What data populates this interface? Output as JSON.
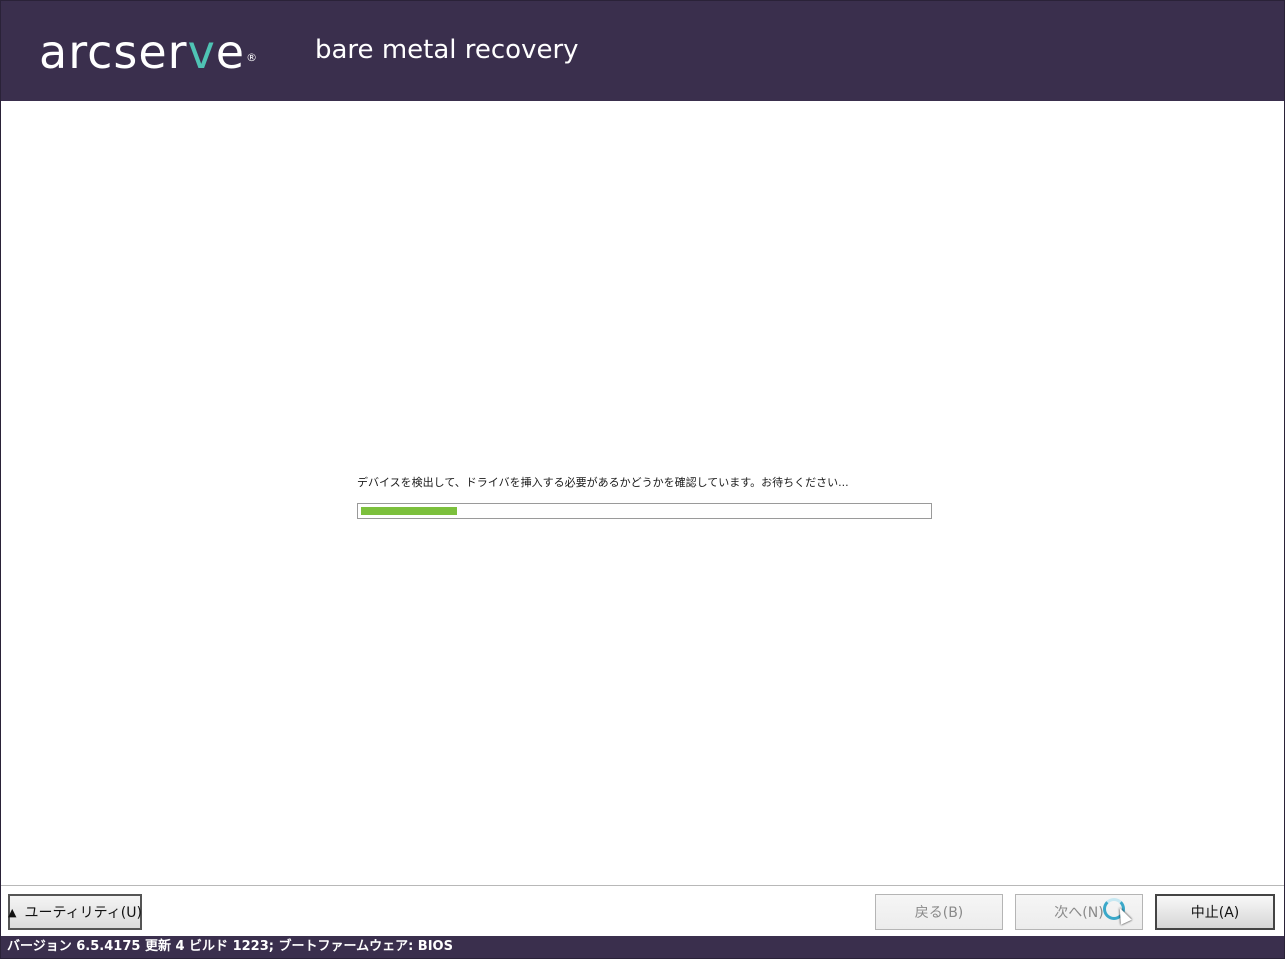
{
  "header": {
    "logo_prefix": "arcser",
    "logo_accent": "v",
    "logo_suffix": "e",
    "logo_reg": "®",
    "product_name": "bare metal recovery"
  },
  "main": {
    "status_message": "デバイスを検出して、ドライバを挿入する必要があるかどうかを確認しています。お待ちください...",
    "progress": 0.17
  },
  "footer": {
    "utility_label": "ユーティリティ(U)",
    "back_label": "戻る(B)",
    "next_label": "次へ(N)",
    "abort_label": "中止(A)"
  },
  "statusbar": {
    "text": "バージョン 6.5.4175 更新 4 ビルド 1223; ブートファームウェア: BIOS"
  },
  "colors": {
    "brand_bg": "#3a2f4d",
    "logo_accent": "#4fc3b4",
    "progress_fill": "#7cc03d"
  },
  "icons": {
    "utility_arrow": "triangle-up-icon",
    "busy": "loading-spinner-icon",
    "pointer": "mouse-cursor-icon"
  }
}
